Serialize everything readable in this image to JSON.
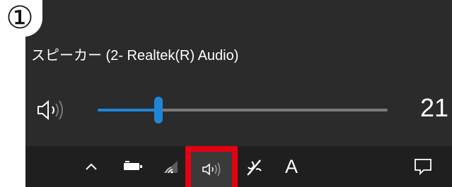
{
  "annotation": {
    "step_label": "①"
  },
  "flyout": {
    "device_name": "スピーカー (2- Realtek(R) Audio)",
    "volume": {
      "value": 21,
      "value_text": "21",
      "max": 100,
      "speaker_icon": "speaker-icon"
    }
  },
  "taskbar": {
    "icons": [
      "chevron-up-icon",
      "battery-icon",
      "wifi-icon",
      "volume-icon",
      "pen-icon",
      "ime-icon",
      "notification-icon"
    ],
    "ime_label": "A",
    "highlighted_item": "volume-icon"
  },
  "colors": {
    "flyout_background": "#2b2b2b",
    "taskbar_background": "#1f1f1f",
    "accent": "#1e86d9",
    "slider_track": "#7a7a7a",
    "highlight": "#e60012"
  }
}
